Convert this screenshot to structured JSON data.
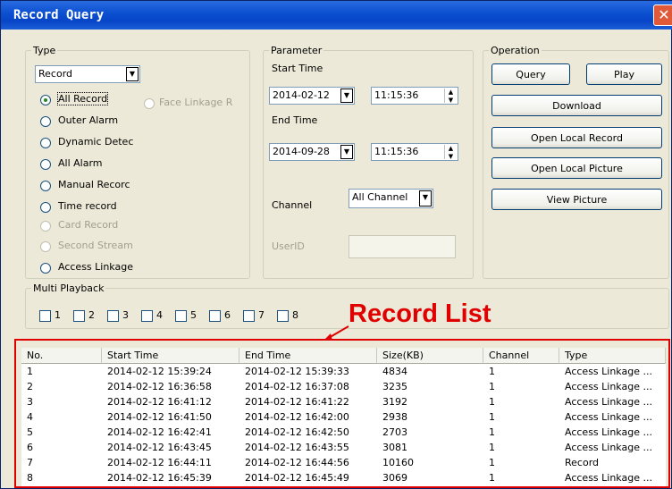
{
  "window": {
    "title": "Record Query",
    "close_icon": "close-icon"
  },
  "type_group": {
    "legend": "Type",
    "select_value": "Record",
    "radios": [
      {
        "label": "All Record",
        "checked": true,
        "enabled": true
      },
      {
        "label": "Outer Alarm",
        "checked": false,
        "enabled": true
      },
      {
        "label": "Dynamic Detec",
        "checked": false,
        "enabled": true
      },
      {
        "label": "All Alarm",
        "checked": false,
        "enabled": true
      },
      {
        "label": "Manual Recorc",
        "checked": false,
        "enabled": true
      },
      {
        "label": "Time record",
        "checked": false,
        "enabled": true
      },
      {
        "label": "Card Record",
        "checked": false,
        "enabled": false
      },
      {
        "label": "Second Stream",
        "checked": false,
        "enabled": false
      },
      {
        "label": "Access Linkage",
        "checked": false,
        "enabled": true
      }
    ],
    "face_linkage": {
      "label": "Face Linkage R",
      "checked": false,
      "enabled": false
    }
  },
  "parameter_group": {
    "legend": "Parameter",
    "start_label": "Start Time",
    "start_date": "2014-02-12",
    "start_time": "11:15:36",
    "end_label": "End Time",
    "end_date": "2014-09-28",
    "end_time": "11:15:36",
    "channel_label": "Channel",
    "channel_value": "All Channel",
    "userid_label": "UserID",
    "userid_value": ""
  },
  "operation_group": {
    "legend": "Operation",
    "query": "Query",
    "play": "Play",
    "download": "Download",
    "open_local_record": "Open Local Record",
    "open_local_picture": "Open Local Picture",
    "view_picture": "View Picture"
  },
  "multi_playback": {
    "legend": "Multi Playback",
    "options": [
      "1",
      "2",
      "3",
      "4",
      "5",
      "6",
      "7",
      "8"
    ]
  },
  "annotation": {
    "text": "Record List",
    "color": "#e00000"
  },
  "record_list": {
    "columns": [
      "No.",
      "Start Time",
      "End Time",
      "Size(KB)",
      "Channel",
      "Type"
    ],
    "rows": [
      [
        "1",
        "2014-02-12 15:39:24",
        "2014-02-12 15:39:33",
        "4834",
        "1",
        "Access Linkage ..."
      ],
      [
        "2",
        "2014-02-12 16:36:58",
        "2014-02-12 16:37:08",
        "3235",
        "1",
        "Access Linkage ..."
      ],
      [
        "3",
        "2014-02-12 16:41:12",
        "2014-02-12 16:41:22",
        "3192",
        "1",
        "Access Linkage ..."
      ],
      [
        "4",
        "2014-02-12 16:41:50",
        "2014-02-12 16:42:00",
        "2938",
        "1",
        "Access Linkage ..."
      ],
      [
        "5",
        "2014-02-12 16:42:41",
        "2014-02-12 16:42:50",
        "2703",
        "1",
        "Access Linkage ..."
      ],
      [
        "6",
        "2014-02-12 16:43:45",
        "2014-02-12 16:43:55",
        "3081",
        "1",
        "Access Linkage ..."
      ],
      [
        "7",
        "2014-02-12 16:44:11",
        "2014-02-12 16:44:56",
        "10160",
        "1",
        "Record"
      ],
      [
        "8",
        "2014-02-12 16:45:39",
        "2014-02-12 16:45:49",
        "3069",
        "1",
        "Access Linkage ..."
      ]
    ]
  }
}
